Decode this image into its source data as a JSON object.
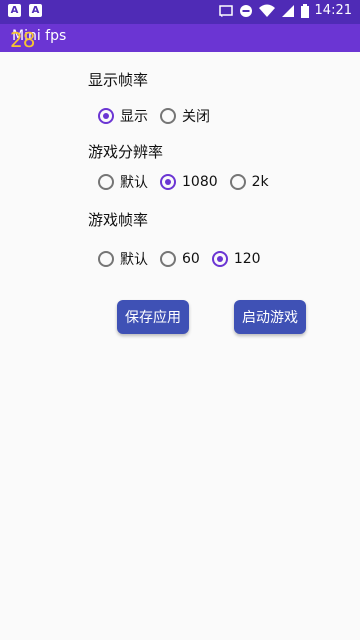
{
  "status_bar": {
    "left_icons": [
      "A",
      "A"
    ],
    "time": "14:21"
  },
  "app": {
    "title": "Mini fps",
    "fps_overlay": "28"
  },
  "sections": [
    {
      "title": "显示帧率",
      "options": [
        "显示",
        "关闭"
      ],
      "selected": "显示"
    },
    {
      "title": "游戏分辨率",
      "options": [
        "默认",
        "1080",
        "2k"
      ],
      "selected": "1080"
    },
    {
      "title": "游戏帧率",
      "options": [
        "默认",
        "60",
        "120"
      ],
      "selected": "120"
    }
  ],
  "buttons": {
    "save": "保存应用",
    "launch": "启动游戏"
  },
  "colors": {
    "status_bar": "#4f2bb6",
    "app_bar": "#6b35d3",
    "accent": "#6b35d3",
    "button": "#3f51b5",
    "fps_overlay": "#f6c431"
  }
}
